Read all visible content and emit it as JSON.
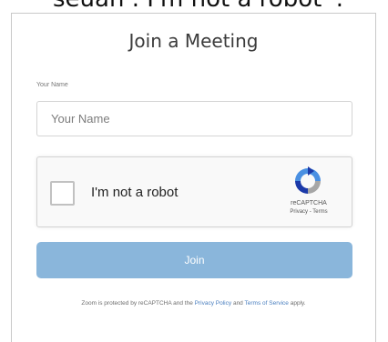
{
  "caption": "seuan . I'm not a robot '.",
  "form": {
    "title": "Join a Meeting",
    "name_label": "Your Name",
    "name_placeholder": "Your Name",
    "name_value": ""
  },
  "captcha": {
    "checkbox_label": "I'm not a robot",
    "brand": "reCAPTCHA",
    "privacy_terms": "Privacy - Terms",
    "logo_icon": "recaptcha-logo-icon"
  },
  "join_button": {
    "label": "Join",
    "color": "#8ab6db"
  },
  "footer": {
    "text_before": "Zoom is protected by reCAPTCHA and the",
    "privacy_link": "Privacy Policy",
    "and": "and",
    "terms_link": "Terms of Service",
    "text_after": "apply."
  }
}
